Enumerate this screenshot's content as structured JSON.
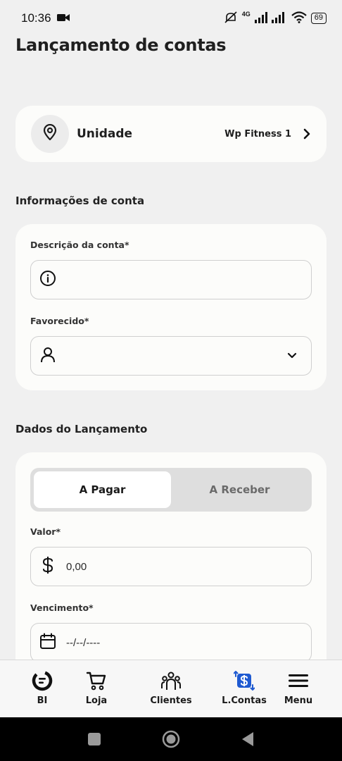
{
  "status_bar": {
    "time": "10:36",
    "network": "4G",
    "battery": "69"
  },
  "page": {
    "title": "Lançamento de contas"
  },
  "unit_card": {
    "label": "Unidade",
    "value": "Wp Fitness 1",
    "icons": [
      "location-pin-icon",
      "chevron-right-icon"
    ]
  },
  "account_info": {
    "section_title": "Informações de conta",
    "description_label": "Descrição da conta*",
    "description_value": "",
    "payee_label": "Favorecido*",
    "payee_value": ""
  },
  "launch_data": {
    "section_title": "Dados do Lançamento",
    "tabs": [
      {
        "label": "A Pagar",
        "active": true
      },
      {
        "label": "A Receber",
        "active": false
      }
    ],
    "value_label": "Valor*",
    "value_value": "0,00",
    "due_label": "Vencimento*",
    "due_value": "--/--/----"
  },
  "bottom_nav": [
    {
      "label": "BI",
      "icon": "bi-chart-icon",
      "active": false
    },
    {
      "label": "Loja",
      "icon": "cart-icon",
      "active": false
    },
    {
      "label": "Clientes",
      "icon": "people-icon",
      "active": false
    },
    {
      "label": "L.Contas",
      "icon": "account-transfer-icon",
      "active": true
    },
    {
      "label": "Menu",
      "icon": "hamburger-menu-icon",
      "active": false
    }
  ],
  "colors": {
    "background": "#f0f0f0",
    "card": "#fcfcfa",
    "accent_blue": "#1f5ad1"
  }
}
